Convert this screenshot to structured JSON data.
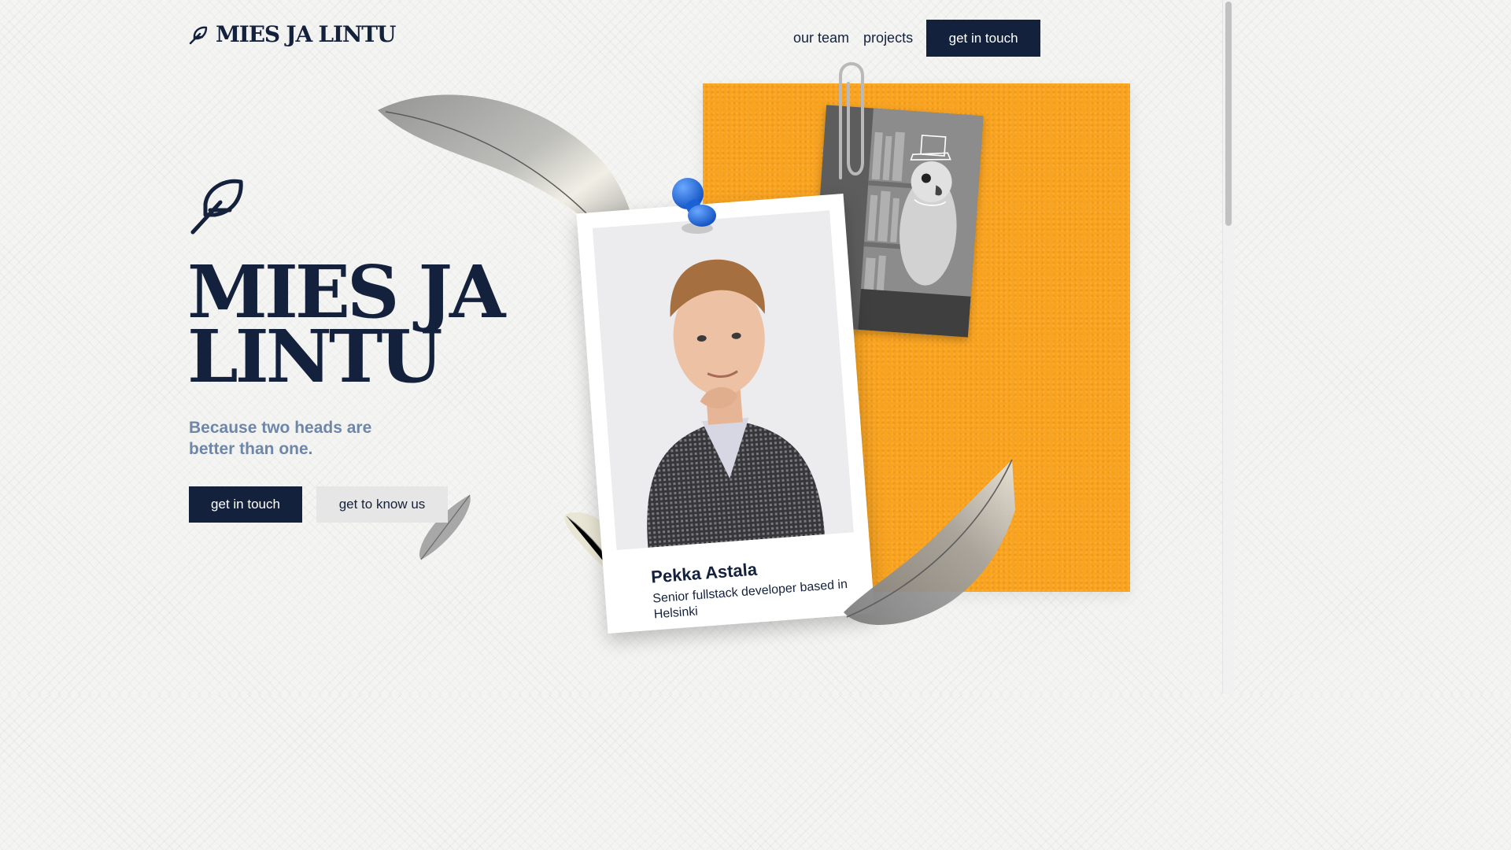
{
  "header": {
    "logo_text": "MIES JA LINTU",
    "nav": [
      {
        "label": "our team"
      },
      {
        "label": "projects"
      }
    ],
    "cta_label": "get in touch"
  },
  "hero": {
    "title_line1": "MIES JA",
    "title_line2": "LINTU",
    "tagline": "Because two heads are better than one.",
    "primary_button": "get in touch",
    "secondary_button": "get to know us"
  },
  "profile_card": {
    "name": "Pekka Astala",
    "role": "Senior fullstack developer based in Helsinki"
  },
  "colors": {
    "navy": "#14213d",
    "orange": "#f9a31f",
    "tagline_blue": "#6e86a8",
    "pin_blue": "#1f6fe0"
  },
  "icons": [
    "feather-icon",
    "pushpin-icon",
    "paperclip-icon"
  ]
}
